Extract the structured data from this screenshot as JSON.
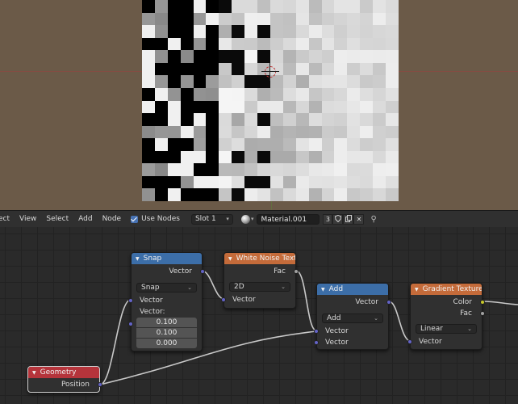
{
  "header": {
    "menu_partial": "ect",
    "menu_view": "View",
    "menu_select": "Select",
    "menu_add": "Add",
    "menu_node": "Node",
    "use_nodes_label": "Use Nodes",
    "slot_value": "Slot 1",
    "material_name": "Material.001",
    "user_count": "3"
  },
  "nodes": {
    "snap": {
      "title": "Snap",
      "out_vector": "Vector",
      "operation": "Snap",
      "in_vector": "Vector",
      "increment_label": "Vector:",
      "increment": [
        "0.100",
        "0.100",
        "0.000"
      ]
    },
    "white_noise": {
      "title": "White Noise Textur",
      "out_fac": "Fac",
      "dimensions": "2D",
      "in_vector": "Vector"
    },
    "add": {
      "title": "Add",
      "out_vector": "Vector",
      "operation": "Add",
      "in_vector_a": "Vector",
      "in_vector_b": "Vector"
    },
    "gradient": {
      "title": "Gradient Texture",
      "out_color": "Color",
      "out_fac": "Fac",
      "type": "Linear",
      "in_vector": "Vector"
    },
    "geometry": {
      "title": "Geometry",
      "out_position": "Position"
    }
  },
  "colors": {
    "viewport_bg": "#6b5a48",
    "vector_header": "#3c6ea8",
    "texture_header": "#c46b3a",
    "input_header": "#b5343b",
    "vector_socket": "#6363c7",
    "checkbox_accent": "#4772b3"
  },
  "icons": [
    "checkbox-icon",
    "material-sphere-icon",
    "fake-user-shield-icon",
    "duplicate-icon",
    "close-icon",
    "pin-icon",
    "3d-cursor-icon",
    "collapse-triangle-icon",
    "chevron-down-icon"
  ]
}
